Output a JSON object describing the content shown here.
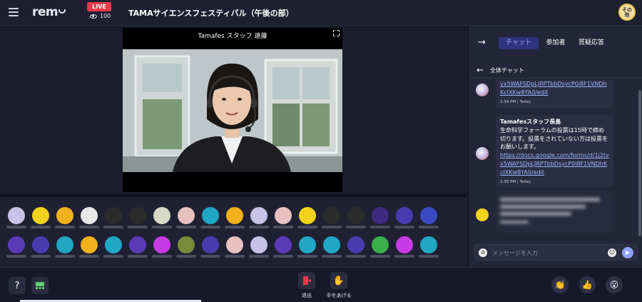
{
  "header": {
    "logo": "rem",
    "live_label": "LIVE",
    "viewer_count": "100",
    "event_title": "TAMAサイエンスフェスティバル（午後の部）",
    "user_avatar_text": "その他"
  },
  "stage": {
    "presenter_name": "Tamafes スタッフ 遠藤"
  },
  "audience": {
    "row1_colors": [
      "#c9c2e8",
      "#f2d21c",
      "#f2b01c",
      "#e8e8e8",
      "#2b2b2b",
      "#2b2b2b",
      "#d8d8c8",
      "#e8c0c0",
      "#1fa7c4",
      "#f2b01c",
      "#c9c2e8",
      "#e8c0c0",
      "#f2d21c",
      "#2b2b2b",
      "#2b2b2b",
      "#3c2a80",
      "#4a3ab0",
      "#3a4ac0"
    ],
    "row2_colors": [
      "#5b3ab8",
      "#4a3ab0",
      "#1fa7c4",
      "#f2b01c",
      "#1fa7c4",
      "#5b3ab8",
      "#c73ae6",
      "#7a8a3a",
      "#4a3ab0",
      "#e8c0c0",
      "#c9c2e8",
      "#5b3ab8",
      "#1fa7c4",
      "#1fa7c4",
      "#4a3ab0",
      "#3ab04a",
      "#c73ae6",
      "#1fa7c4"
    ]
  },
  "bottom": {
    "leave_label": "退出",
    "raise_hand_label": "手をあげる",
    "help_icon": "question-icon",
    "layout_icon": "layout-icon"
  },
  "panel": {
    "tabs": [
      "チャット",
      "参加者",
      "質疑応答"
    ],
    "chat_title": "全体チャット",
    "messages": [
      {
        "link": "vx5WAFSDpLJRPTbbDsycP0i8F1VNDhKcIXKw8YA0/edit",
        "time": "2:34 PM | Today"
      },
      {
        "author": "Tamafesスタッフ長島",
        "text": "生命科学フォーラムの投票は15時で締め切ります。投票をされていない方は投票をお願いします。",
        "link": "https://docs.google.com/forms/d/1j2tvx5WAFSDpLJRPTbbDsycP0i8F1VNDhKcIXKw8YA0/edit",
        "time": "2:35 PM | Today"
      }
    ],
    "input_placeholder": "メッセージを入力"
  },
  "colors": {
    "accent": "#8ea2ff",
    "live": "#e83a4a",
    "background": "#1b1d2e"
  }
}
